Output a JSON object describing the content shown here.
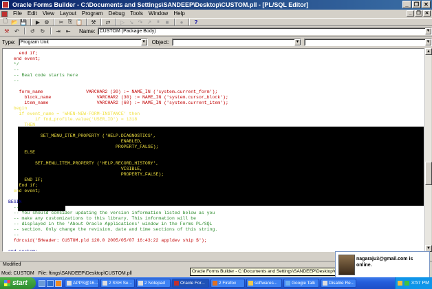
{
  "window": {
    "title": "Oracle Forms Builder - C:\\Documents and Settings\\SANDEEP\\Desktop\\CUSTOM.pll - [PL/SQL Editor]"
  },
  "menu": [
    "File",
    "Edit",
    "View",
    "Layout",
    "Program",
    "Debug",
    "Tools",
    "Window",
    "Help"
  ],
  "editor": {
    "name_label": "Name:",
    "name_value": "CUSTOM (Package Body)",
    "type_label": "Type:",
    "type_value": "Program Unit",
    "object_label": "Object:",
    "object_value": ""
  },
  "code_lines": [
    {
      "text": "    end if;",
      "cls": "c-red"
    },
    {
      "text": "  end event;",
      "cls": "c-red"
    },
    {
      "text": "  */",
      "cls": "c-com"
    },
    {
      "text": "  --",
      "cls": "c-com"
    },
    {
      "text": "  -- Real code starts here",
      "cls": "c-com"
    },
    {
      "text": "  --",
      "cls": "c-com"
    },
    {
      "text": "",
      "cls": "c-blk"
    },
    {
      "text": "    form_name                VARCHAR2 (30) := NAME_IN ('system.current_form');",
      "cls": "c-red"
    },
    {
      "text": "      block_name                 VARCHAR2 (30) := NAME_IN ('system.cursor_block');",
      "cls": "c-red"
    },
    {
      "text": "      item_name                  VARCHAR2 (60) := NAME_IN ('system.current_item');",
      "cls": "c-red"
    },
    {
      "text": "  begin",
      "cls": "c-sel"
    },
    {
      "text": "    if event_name = 'WHEN-NEW-FORM-INSTANCE' then",
      "cls": "c-sel"
    },
    {
      "text": "          if fnd_profile.value('USER_ID') = 1318",
      "cls": "c-sel"
    },
    {
      "text": "      THEN",
      "cls": "c-sel"
    },
    {
      "text": "",
      "cls": "c-sel"
    },
    {
      "text": "            SET_MENU_ITEM_PROPERTY ('HELP.DIAGNOSTICS',",
      "cls": "c-sel"
    },
    {
      "text": "                                          ENABLED,",
      "cls": "c-sel"
    },
    {
      "text": "                                        PROPERTY_FALSE);",
      "cls": "c-sel"
    },
    {
      "text": "      ELSE",
      "cls": "c-sel"
    },
    {
      "text": "",
      "cls": "c-sel"
    },
    {
      "text": "          SET_MENU_ITEM_PROPERTY ('HELP.RECORD_HISTORY',",
      "cls": "c-sel"
    },
    {
      "text": "                                          VISIBLE,",
      "cls": "c-sel"
    },
    {
      "text": "                                          PROPERTY_FALSE);",
      "cls": "c-sel"
    },
    {
      "text": "      END IF;",
      "cls": "c-sel"
    },
    {
      "text": "    End if;",
      "cls": "c-sel"
    },
    {
      "text": "  end event;",
      "cls": "c-sel"
    },
    {
      "text": "",
      "cls": "c-blk"
    },
    {
      "text": "BEGIN",
      "cls": "c-kw"
    },
    {
      "text": "  --",
      "cls": "c-com"
    },
    {
      "text": "  -- You should consider updating the version information listed below as you",
      "cls": "c-com"
    },
    {
      "text": "  -- make any customizations to this library. This information will be",
      "cls": "c-com"
    },
    {
      "text": "  -- displayed in the 'About Oracle Applications' window in the Forms PL/SQL",
      "cls": "c-com"
    },
    {
      "text": "  -- section. Only change the revision, date and time sections of this string.",
      "cls": "c-com"
    },
    {
      "text": "  --",
      "cls": "c-com"
    },
    {
      "text": "  fdrcsid('$Header: CUSTOM.pld 120.0 2005/05/07 16:43:22 appldev ship $');",
      "cls": "c-red"
    },
    {
      "text": "",
      "cls": "c-blk"
    },
    {
      "text": "end custom;",
      "cls": "c-kw"
    }
  ],
  "status": {
    "modified": "Modified",
    "module": "Mod: CUSTOM",
    "file": "File: ftings\\SANDEEP\\Desktop\\CUSTOM.pll"
  },
  "tooltip": "Oracle Forms Builder - C:\\Documents and Settings\\SANDEEP\\Desktop\\CUSTOM.pll",
  "notification": {
    "message": "nagaraju3@gmail.com is online."
  },
  "taskbar": {
    "start_label": "start",
    "tasks": [
      "APPS@16...",
      "2 SSH Se...",
      "2 Notepad",
      "Oracle For...",
      "2 Firefox",
      "softwares...",
      "Google Talk",
      "Disable Re..."
    ],
    "clock": "3:57 PM"
  }
}
